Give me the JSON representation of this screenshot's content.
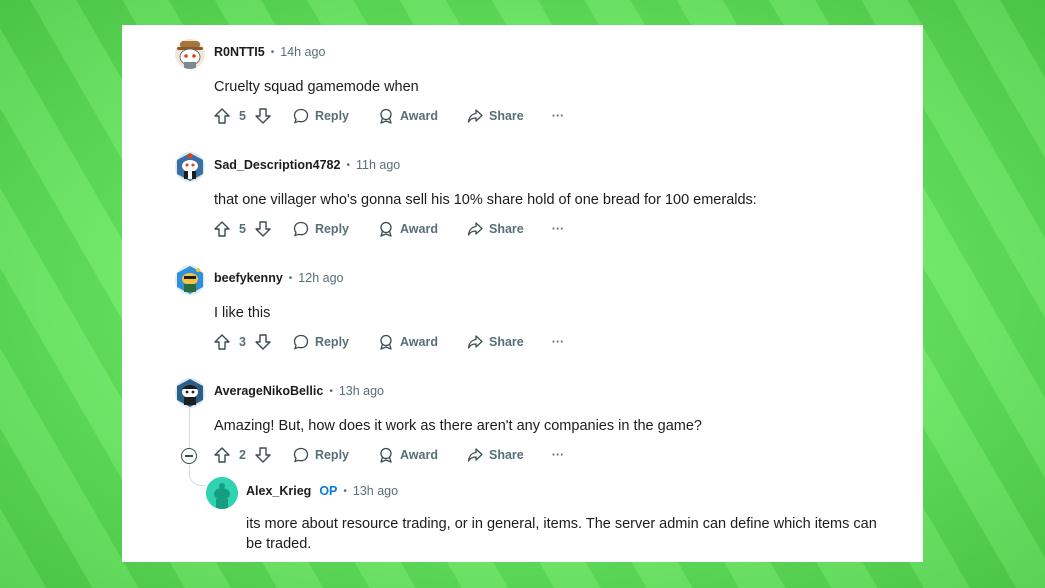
{
  "comments": [
    {
      "author": "R0NTTI5",
      "time": "14h ago",
      "text": "Cruelty squad gamemode when",
      "votes": "5",
      "avatar_icon": "snoo-cowboy-avatar",
      "avatar_color": "#c98a4b"
    },
    {
      "author": "Sad_Description4782",
      "time": "11h ago",
      "text": "that one villager who's gonna sell his 10% share hold of one bread for 100 emeralds:",
      "votes": "5",
      "avatar_icon": "snoo-hexagon-avatar",
      "avatar_color": "#3a6fa6"
    },
    {
      "author": "beefykenny",
      "time": "12h ago",
      "text": "I like this",
      "votes": "3",
      "avatar_icon": "snoo-hexagon-avatar",
      "avatar_color": "#2f8fd8"
    },
    {
      "author": "AverageNikoBellic",
      "time": "13h ago",
      "text": "Amazing! But, how does it work as there aren't any companies in the game?",
      "votes": "2",
      "avatar_icon": "snoo-hexagon-avatar",
      "avatar_color": "#2a5f86"
    }
  ],
  "reply": {
    "author": "Alex_Krieg",
    "op_badge": "OP",
    "time": "13h ago",
    "text": "its more about resource trading, or in general, items. The server admin can define which items can be traded.",
    "avatar_icon": "snoo-default-avatar",
    "avatar_color": "#2fd3b0"
  },
  "actions": {
    "reply": "Reply",
    "award": "Award",
    "share": "Share",
    "more": "···"
  }
}
